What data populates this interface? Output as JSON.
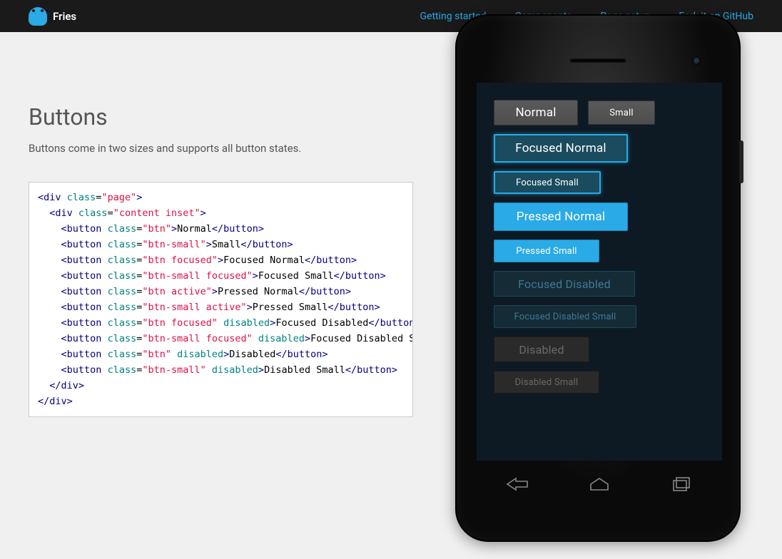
{
  "header": {
    "brand": "Fries",
    "nav": [
      "Getting started",
      "Components",
      "Page setup",
      "Fork it on GitHub"
    ]
  },
  "section": {
    "title": "Buttons",
    "description": "Buttons come in two sizes and supports all button states."
  },
  "code": {
    "lines": [
      {
        "indent": 0,
        "type": "open",
        "tag": "div",
        "attrs": [
          {
            "n": "class",
            "v": "page"
          }
        ]
      },
      {
        "indent": 1,
        "type": "open",
        "tag": "div",
        "attrs": [
          {
            "n": "class",
            "v": "content inset"
          }
        ]
      },
      {
        "indent": 2,
        "type": "el",
        "tag": "button",
        "attrs": [
          {
            "n": "class",
            "v": "btn"
          }
        ],
        "text": "Normal"
      },
      {
        "indent": 2,
        "type": "el",
        "tag": "button",
        "attrs": [
          {
            "n": "class",
            "v": "btn-small"
          }
        ],
        "text": "Small"
      },
      {
        "indent": 2,
        "type": "el",
        "tag": "button",
        "attrs": [
          {
            "n": "class",
            "v": "btn focused"
          }
        ],
        "text": "Focused Normal"
      },
      {
        "indent": 2,
        "type": "el",
        "tag": "button",
        "attrs": [
          {
            "n": "class",
            "v": "btn-small focused"
          }
        ],
        "text": "Focused Small"
      },
      {
        "indent": 2,
        "type": "el",
        "tag": "button",
        "attrs": [
          {
            "n": "class",
            "v": "btn active"
          }
        ],
        "text": "Pressed Normal"
      },
      {
        "indent": 2,
        "type": "el",
        "tag": "button",
        "attrs": [
          {
            "n": "class",
            "v": "btn-small active"
          }
        ],
        "text": "Pressed Small"
      },
      {
        "indent": 2,
        "type": "el",
        "tag": "button",
        "attrs": [
          {
            "n": "class",
            "v": "btn focused"
          }
        ],
        "disabled": true,
        "text": "Focused Disabled"
      },
      {
        "indent": 2,
        "type": "el",
        "tag": "button",
        "attrs": [
          {
            "n": "class",
            "v": "btn-small focused"
          }
        ],
        "disabled": true,
        "text": "Focused Disabled Small"
      },
      {
        "indent": 2,
        "type": "el",
        "tag": "button",
        "attrs": [
          {
            "n": "class",
            "v": "btn"
          }
        ],
        "disabled": true,
        "text": "Disabled"
      },
      {
        "indent": 2,
        "type": "el",
        "tag": "button",
        "attrs": [
          {
            "n": "class",
            "v": "btn-small"
          }
        ],
        "disabled": true,
        "text": "Disabled Small"
      },
      {
        "indent": 1,
        "type": "close",
        "tag": "div"
      },
      {
        "indent": 0,
        "type": "close",
        "tag": "div"
      }
    ]
  },
  "demo_buttons": {
    "normal": "Normal",
    "small": "Small",
    "focused_normal": "Focused Normal",
    "focused_small": "Focused Small",
    "pressed_normal": "Pressed Normal",
    "pressed_small": "Pressed Small",
    "focused_disabled": "Focused Disabled",
    "focused_disabled_small": "Focused Disabled Small",
    "disabled": "Disabled",
    "disabled_small": "Disabled Small"
  }
}
